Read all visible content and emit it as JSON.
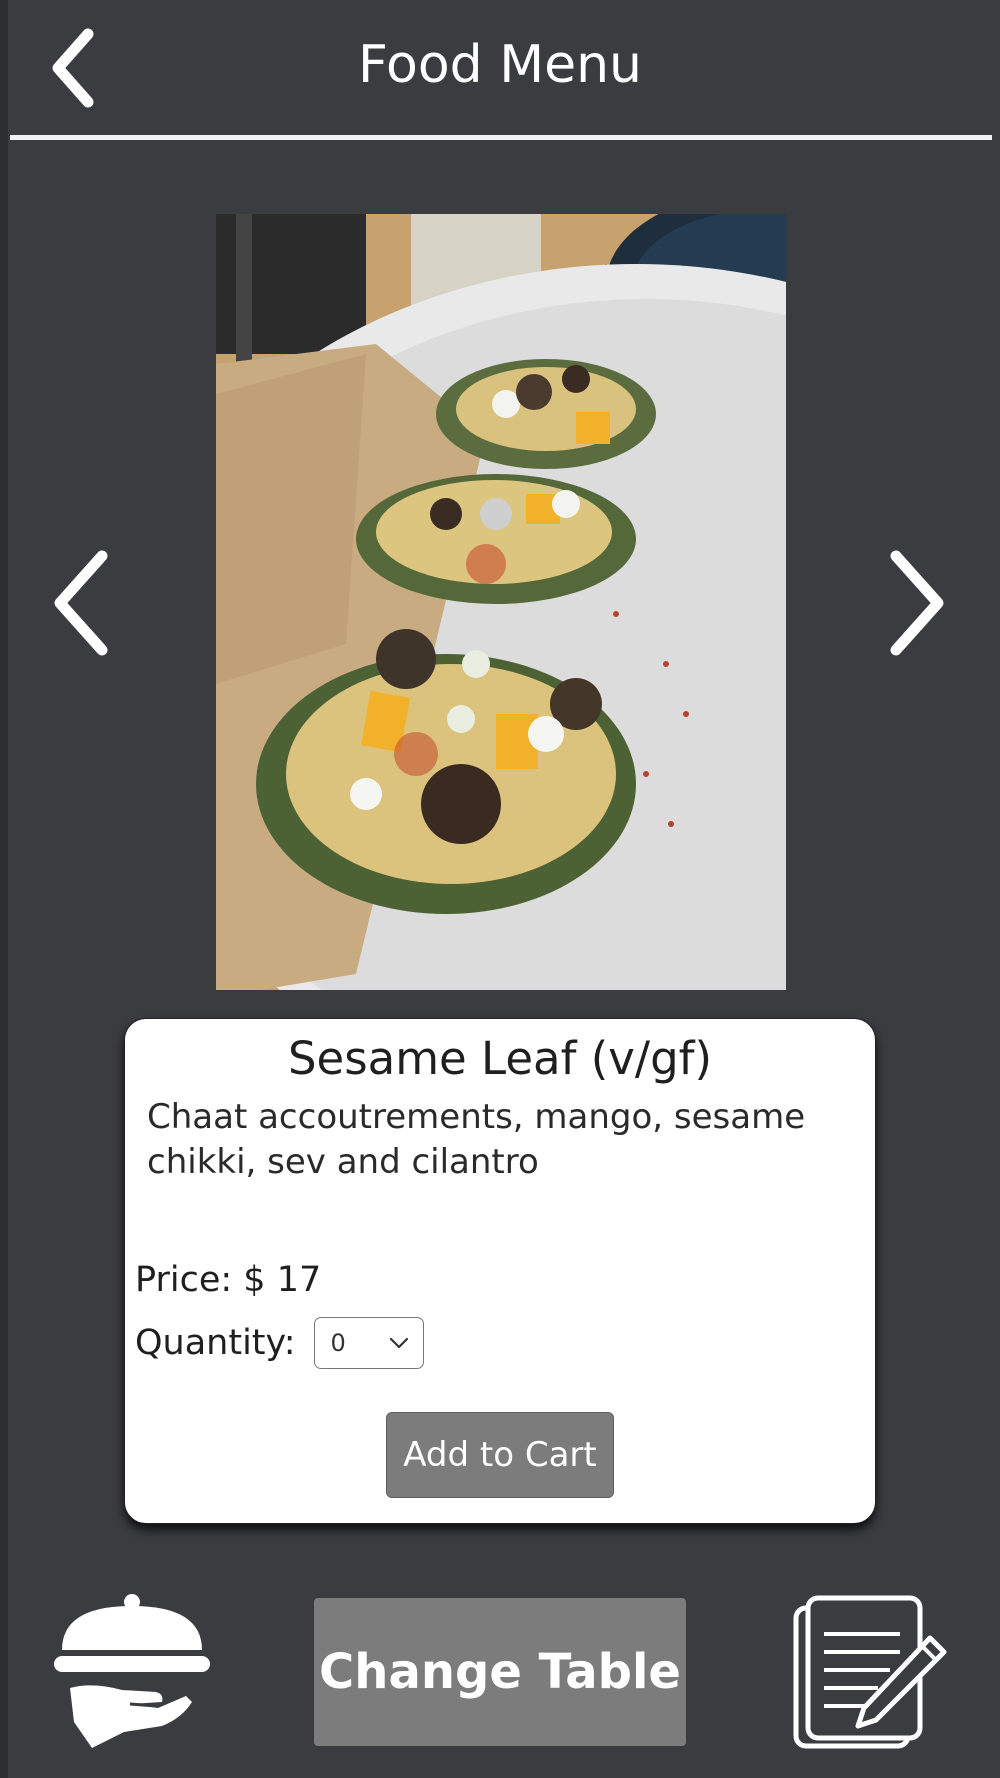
{
  "header": {
    "title": "Food Menu",
    "back_icon": "chevron-left-icon"
  },
  "carousel": {
    "prev_icon": "chevron-left-icon",
    "next_icon": "chevron-right-icon"
  },
  "item": {
    "name": "Sesame Leaf (v/gf)",
    "description": "Chaat accoutrements, mango, sesame chikki, sev and cilantro",
    "price_label": "Price: $ 17",
    "quantity_label": "Quantity:",
    "quantity_value": "0",
    "add_to_cart_label": "Add to Cart"
  },
  "footer": {
    "waiter_icon": "cloche-serving-hand-icon",
    "change_table_label": "Change Table",
    "order_icon": "order-notepad-pencil-icon"
  },
  "colors": {
    "background": "#3b3c40",
    "card": "#ffffff",
    "button": "#7c7c7c",
    "text_light": "#ffffff"
  }
}
